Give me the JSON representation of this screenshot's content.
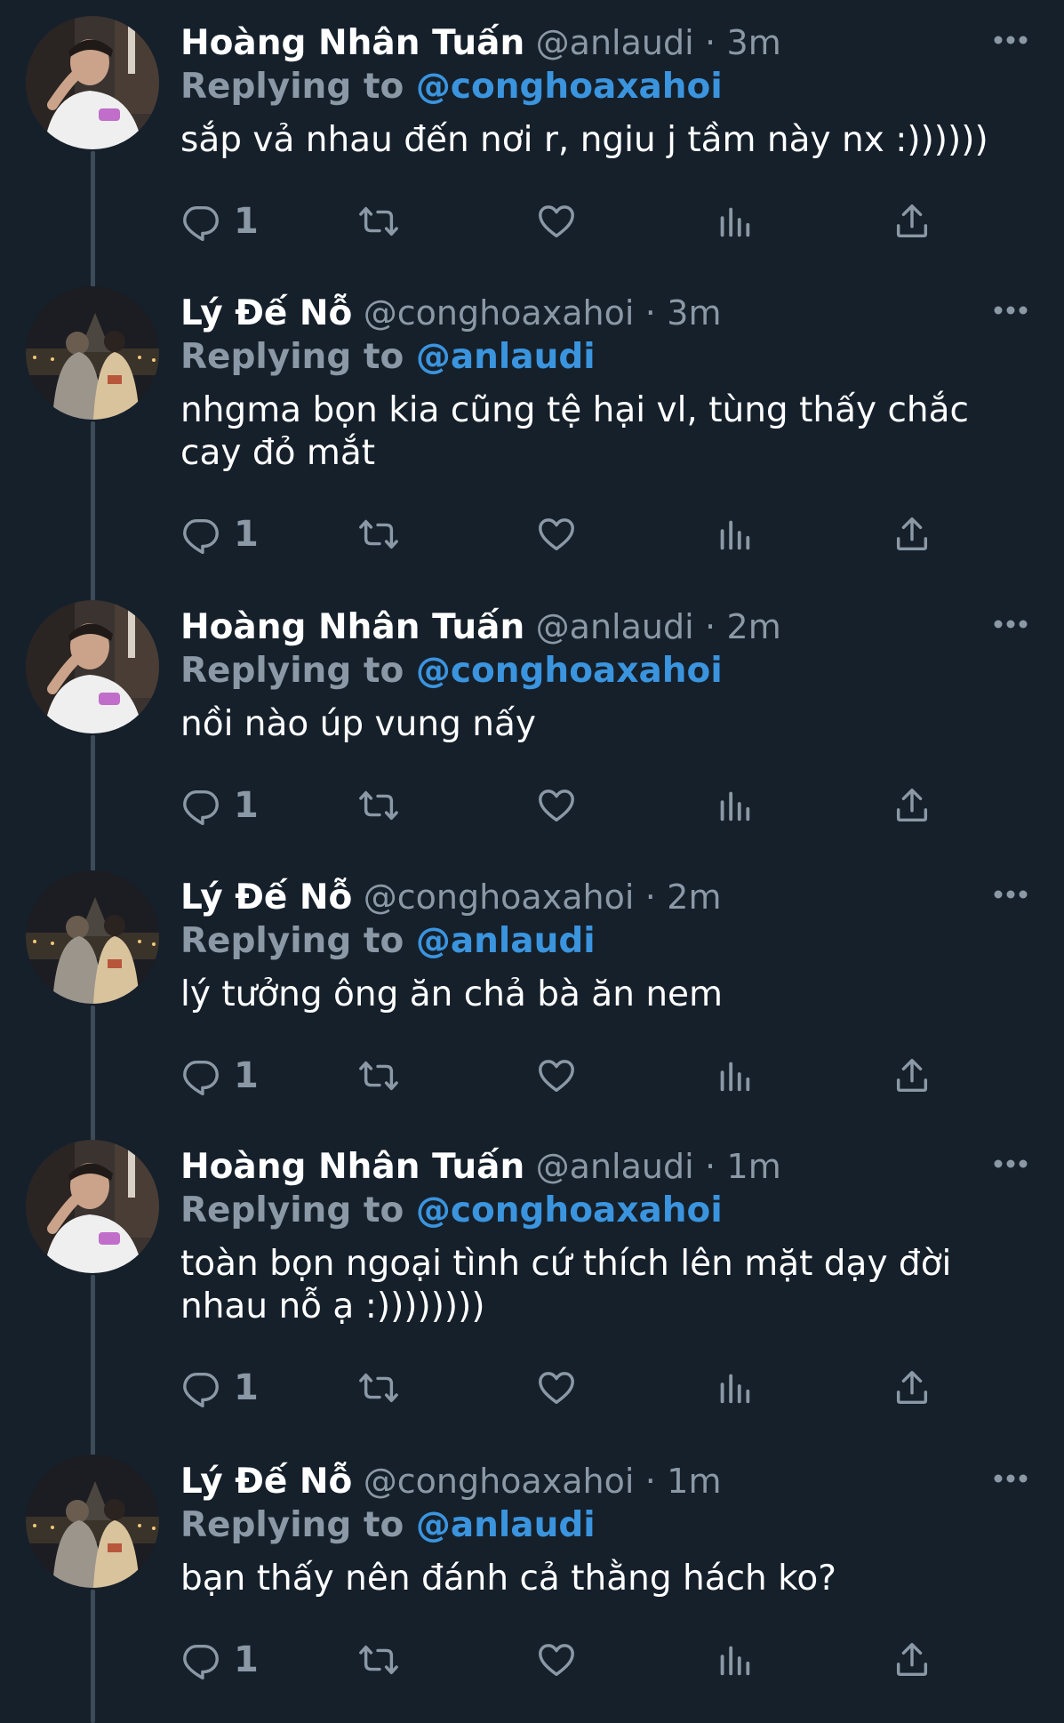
{
  "reply_prefix": "Replying to",
  "tweets": [
    {
      "author": "Hoàng Nhân Tuấn",
      "handle": "@anlaudi",
      "separator": "·",
      "time": "3m",
      "reply_to": "@conghoaxahoi",
      "text": "sắp vả nhau đến nơi r, ngiu j tầm này nx :))))))",
      "reply_count": "1",
      "avatar": "avatar-white-shirt"
    },
    {
      "author": "Lý Đế Nỗ",
      "handle": "@conghoaxahoi",
      "separator": "·",
      "time": "3m",
      "reply_to": "@anlaudi",
      "text": "nhgma bọn kia cũng tệ hại vl, tùng thấy chắc cay đỏ mắt",
      "reply_count": "1",
      "avatar": "avatar-couple-night"
    },
    {
      "author": "Hoàng Nhân Tuấn",
      "handle": "@anlaudi",
      "separator": "·",
      "time": "2m",
      "reply_to": "@conghoaxahoi",
      "text": "nồi nào úp vung nấy",
      "reply_count": "1",
      "avatar": "avatar-white-shirt"
    },
    {
      "author": "Lý Đế Nỗ",
      "handle": "@conghoaxahoi",
      "separator": "·",
      "time": "2m",
      "reply_to": "@anlaudi",
      "text": "lý tưởng ông ăn chả bà ăn nem",
      "reply_count": "1",
      "avatar": "avatar-couple-night"
    },
    {
      "author": "Hoàng Nhân Tuấn",
      "handle": "@anlaudi",
      "separator": "·",
      "time": "1m",
      "reply_to": "@conghoaxahoi",
      "text": "toàn bọn ngoại tình cứ thích lên mặt dạy đời nhau nỗ ạ :))))))))",
      "reply_count": "1",
      "avatar": "avatar-white-shirt"
    },
    {
      "author": "Lý Đế Nỗ",
      "handle": "@conghoaxahoi",
      "separator": "·",
      "time": "1m",
      "reply_to": "@anlaudi",
      "text": "bạn thấy nên đánh cả thằng hách ko?",
      "reply_count": "1",
      "avatar": "avatar-couple-night"
    }
  ],
  "colors": {
    "background": "#15202b",
    "secondary_text": "#8b98a5",
    "mention": "#3b94de",
    "thread_line": "#3d4b59"
  }
}
